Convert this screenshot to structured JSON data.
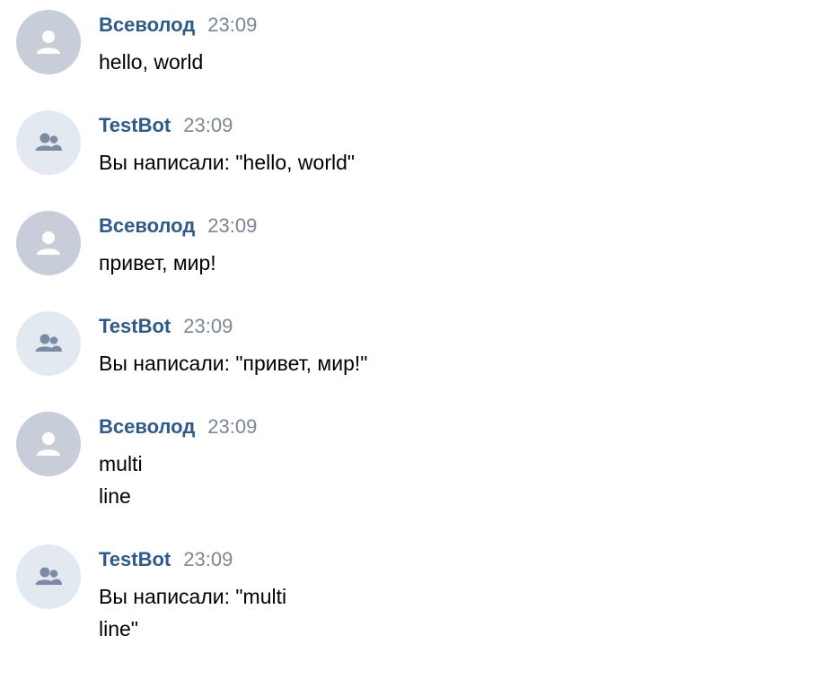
{
  "colors": {
    "author": "#2f5b88",
    "time": "#7d8794",
    "text": "#000000",
    "user_avatar_bg": "#c7ceda",
    "bot_avatar_bg": "#e3e9f1"
  },
  "messages": [
    {
      "author": "Всеволод",
      "time": "23:09",
      "text": "hello, world",
      "avatar": "user-icon"
    },
    {
      "author": "TestBot",
      "time": "23:09",
      "text": "Вы написали: \"hello, world\"",
      "avatar": "group-icon"
    },
    {
      "author": "Всеволод",
      "time": "23:09",
      "text": "привет, мир!",
      "avatar": "user-icon"
    },
    {
      "author": "TestBot",
      "time": "23:09",
      "text": "Вы написали: \"привет, мир!\"",
      "avatar": "group-icon"
    },
    {
      "author": "Всеволод",
      "time": "23:09",
      "text": "multi\nline",
      "avatar": "user-icon"
    },
    {
      "author": "TestBot",
      "time": "23:09",
      "text": "Вы написали: \"multi\nline\"",
      "avatar": "group-icon"
    }
  ]
}
